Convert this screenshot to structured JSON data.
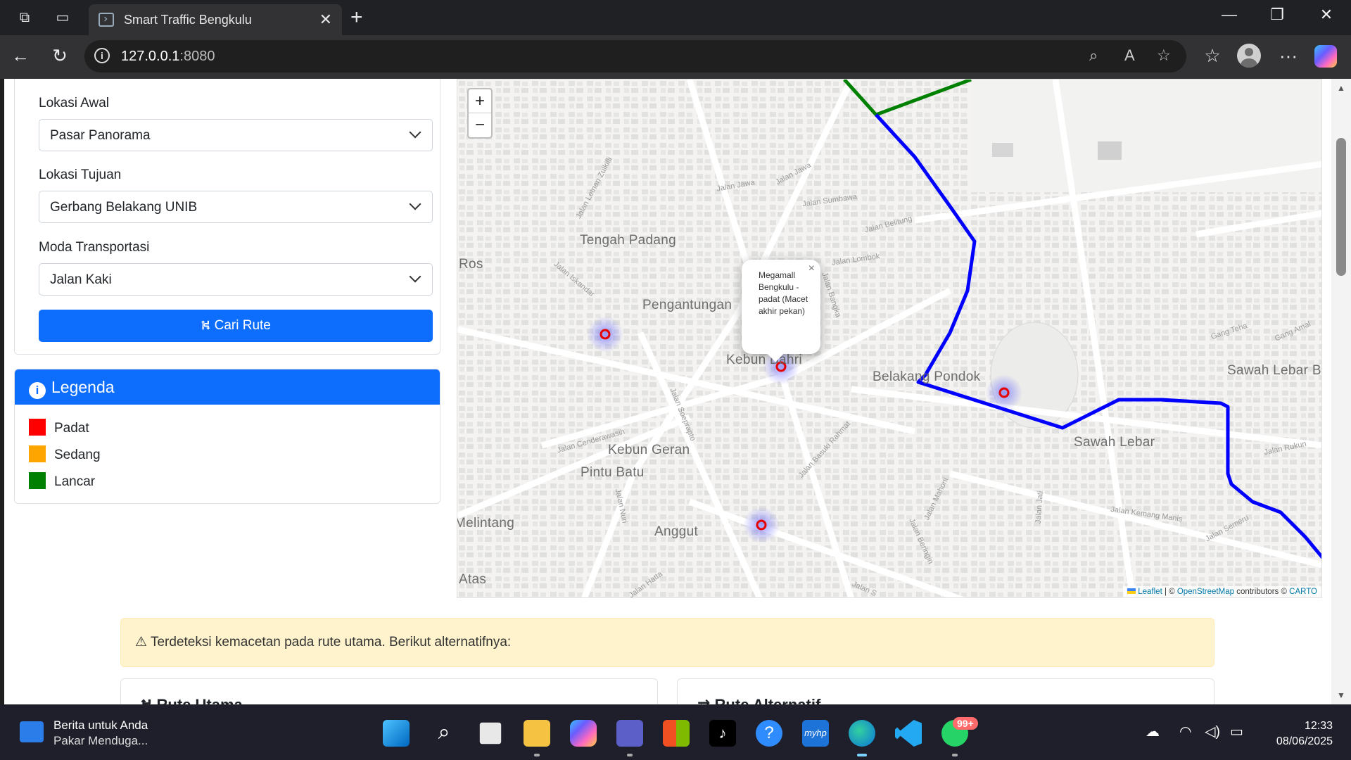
{
  "browser": {
    "tab_title": "Smart Traffic Bengkulu",
    "url_host": "127.0.0.1",
    "url_port": ":8080"
  },
  "form": {
    "start_label": "Lokasi Awal",
    "start_value": "Pasar Panorama",
    "dest_label": "Lokasi Tujuan",
    "dest_value": "Gerbang Belakang UNIB",
    "mode_label": "Moda Transportasi",
    "mode_value": "Jalan Kaki",
    "search_button": "Cari Rute"
  },
  "legend": {
    "title": "Legenda",
    "items": [
      {
        "label": "Padat",
        "color": "#ff0000"
      },
      {
        "label": "Sedang",
        "color": "#ffa500"
      },
      {
        "label": "Lancar",
        "color": "#008000"
      }
    ]
  },
  "map": {
    "zoom_in": "+",
    "zoom_out": "−",
    "areas": [
      "Tengah Padang",
      "Ros",
      "Pengantungan",
      "Kebun Bahri",
      "Belakang Pondok",
      "Sawah Lebar Baru",
      "Sawah Lebar",
      "Kebun Geran",
      "Pintu Batu",
      "Anggut",
      "Melintang",
      "Atas"
    ],
    "streets": [
      "Jalan Jawa",
      "Jalan Jawa",
      "Jalan Sumbawa",
      "Jalan Belitung",
      "Jalan Lombok",
      "Jalan Bangka",
      "Jalan Iskandar",
      "Jalan Letnan Zulkifli",
      "Jalan Soeprapto",
      "Jalan Cenderawasih",
      "Jalan Basuki Rahmat",
      "Jalan Mahoni",
      "Jalan Beringin",
      "Jalan Jati",
      "Jalan Kemang Manis",
      "Jalan Semeru",
      "Jalan Rukun",
      "Gang Teha",
      "Gang Amal",
      "Jalan Hatta",
      "Jalan Nuri",
      "Jalan S"
    ],
    "popup": {
      "close": "×",
      "text": "Megamall Bengkulu - padat (Macet akhir pekan)"
    },
    "attribution": {
      "leaflet": "Leaflet",
      "sep1": " | © ",
      "osm": "OpenStreetMap",
      "sep2": " contributors © ",
      "carto": "CARTO"
    },
    "route_colors": {
      "main": "#0000ff",
      "alt": "#008000",
      "marker": "#e60000"
    }
  },
  "alert": {
    "text": "Terdeteksi kemacetan pada rute utama. Berikut alternatifnya:"
  },
  "cards": {
    "main": "Rute Utama",
    "alt": "Rute Alternatif"
  },
  "taskbar": {
    "news_title": "Berita untuk Anda",
    "news_sub": "Pakar Menduga...",
    "badge": "99+",
    "time": "12:33",
    "date": "08/06/2025"
  }
}
